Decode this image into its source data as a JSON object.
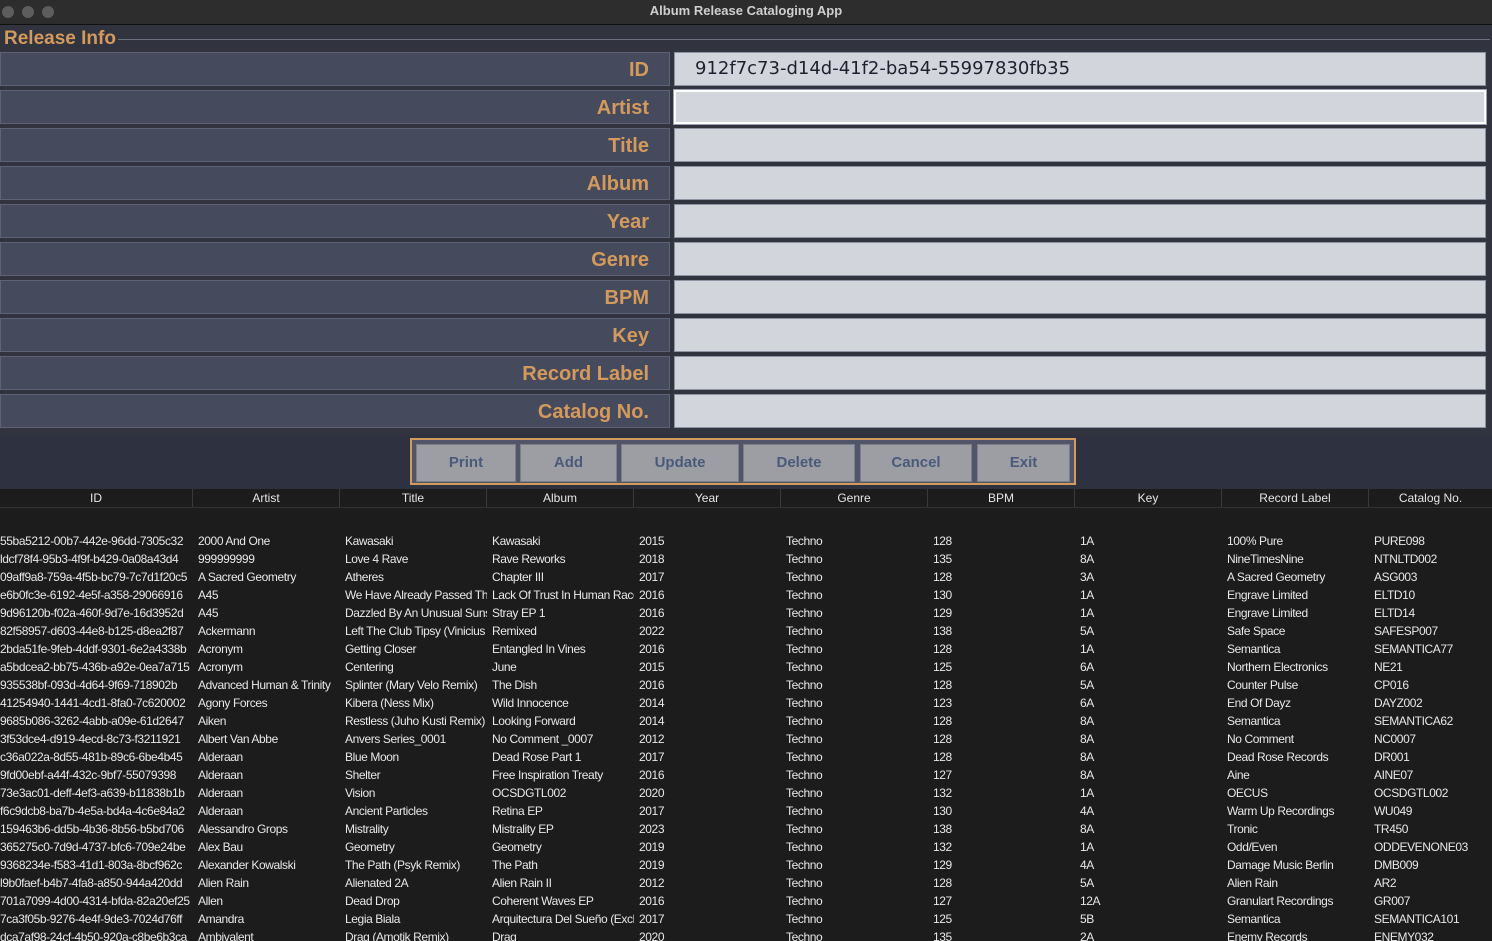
{
  "window": {
    "title": "Album Release Cataloging App"
  },
  "release_info": {
    "legend": "Release Info",
    "fields": [
      {
        "label": "ID",
        "value": "912f7c73-d14d-41f2-ba54-55997830fb35"
      },
      {
        "label": "Artist",
        "value": ""
      },
      {
        "label": "Title",
        "value": ""
      },
      {
        "label": "Album",
        "value": ""
      },
      {
        "label": "Year",
        "value": ""
      },
      {
        "label": "Genre",
        "value": ""
      },
      {
        "label": "BPM",
        "value": ""
      },
      {
        "label": "Key",
        "value": ""
      },
      {
        "label": "Record Label",
        "value": ""
      },
      {
        "label": "Catalog No.",
        "value": ""
      }
    ]
  },
  "buttons": [
    "Print",
    "Add",
    "Update",
    "Delete",
    "Cancel",
    "Exit"
  ],
  "table": {
    "columns": [
      "ID",
      "Artist",
      "Title",
      "Album",
      "Year",
      "Genre",
      "BPM",
      "Key",
      "Record Label",
      "Catalog No."
    ],
    "rows": [
      [
        "55ba5212-00b7-442e-96dd-7305c32",
        "2000 And One",
        "Kawasaki",
        "Kawasaki",
        "2015",
        "Techno",
        "128",
        "1A",
        "100% Pure",
        "PURE098"
      ],
      [
        "ldcf78f4-95b3-4f9f-b429-0a08a43d4",
        "999999999",
        "Love 4 Rave",
        "Rave Reworks",
        "2018",
        "Techno",
        "135",
        "8A",
        "NineTimesNine",
        "NTNLTD002"
      ],
      [
        "09aff9a8-759a-4f5b-bc79-7c7d1f20c5",
        "A Sacred Geometry",
        "Atheres",
        "Chapter III",
        "2017",
        "Techno",
        "128",
        "3A",
        "A Sacred Geometry",
        "ASG003"
      ],
      [
        "e6b0fc3e-6192-4e5f-a358-29066916",
        "A45",
        "We Have Already Passed The F",
        "Lack Of Trust In Human Race",
        "2016",
        "Techno",
        "130",
        "1A",
        "Engrave Limited",
        "ELTD10"
      ],
      [
        "9d96120b-f02a-460f-9d7e-16d3952d",
        "A45",
        "Dazzled By An Unusual Sunsh",
        "Stray EP 1",
        "2016",
        "Techno",
        "129",
        "1A",
        "Engrave Limited",
        "ELTD14"
      ],
      [
        "82f58957-d603-44e8-b125-d8ea2f87",
        "Ackermann",
        "Left The Club Tipsy (Vinicius H",
        "Remixed",
        "2022",
        "Techno",
        "138",
        "5A",
        "Safe Space",
        "SAFESP007"
      ],
      [
        "2bda51fe-9feb-4ddf-9301-6e2a4338b",
        "Acronym",
        "Getting Closer",
        "Entangled In Vines",
        "2016",
        "Techno",
        "128",
        "1A",
        "Semantica",
        "SEMANTICA77"
      ],
      [
        "a5bdcea2-bb75-436b-a92e-0ea7a715",
        "Acronym",
        "Centering",
        "June",
        "2015",
        "Techno",
        "125",
        "6A",
        "Northern Electronics",
        "NE21"
      ],
      [
        "935538bf-093d-4d64-9f69-718902b",
        "Advanced Human & Trinity",
        "Splinter (Mary Velo Remix)",
        "The Dish",
        "2016",
        "Techno",
        "128",
        "5A",
        "Counter Pulse",
        "CP016"
      ],
      [
        "41254940-1441-4cd1-8fa0-7c620002",
        "Agony Forces",
        "Kibera (Ness Mix)",
        "Wild Innocence",
        "2014",
        "Techno",
        "123",
        "6A",
        "End Of Dayz",
        "DAYZ002"
      ],
      [
        "9685b086-3262-4abb-a09e-61d2647",
        "Aiken",
        "Restless (Juho Kusti Remix)",
        "Looking Forward",
        "2014",
        "Techno",
        "128",
        "8A",
        "Semantica",
        "SEMANTICA62"
      ],
      [
        "3f53dce4-d919-4ecd-8c73-f3211921",
        "Albert Van Abbe",
        "Anvers Series_0001",
        "No Comment _0007",
        "2012",
        "Techno",
        "128",
        "8A",
        "No Comment",
        "NC0007"
      ],
      [
        "c36a022a-8d55-481b-89c6-6be4b45",
        "Alderaan",
        "Blue Moon",
        "Dead Rose Part 1",
        "2017",
        "Techno",
        "128",
        "8A",
        "Dead Rose Records",
        "DR001"
      ],
      [
        "9fd00ebf-a44f-432c-9bf7-55079398",
        "Alderaan",
        "Shelter",
        "Free Inspiration Treaty",
        "2016",
        "Techno",
        "127",
        "8A",
        "Aine",
        "AINE07"
      ],
      [
        "73e3ac01-deff-4ef3-a639-b11838b1b",
        "Alderaan",
        "Vision",
        "OCSDGTL002",
        "2020",
        "Techno",
        "132",
        "1A",
        "OECUS",
        "OCSDGTL002"
      ],
      [
        "f6c9dcb8-ba7b-4e5a-bd4a-4c6e84a2",
        "Alderaan",
        "Ancient Particles",
        "Retina EP",
        "2017",
        "Techno",
        "130",
        "4A",
        "Warm Up Recordings",
        "WU049"
      ],
      [
        "159463b6-dd5b-4b36-8b56-b5bd706",
        "Alessandro Grops",
        "Mistrality",
        "Mistrality EP",
        "2023",
        "Techno",
        "138",
        "8A",
        "Tronic",
        "TR450"
      ],
      [
        "365275c0-7d9d-4737-bfc6-709e24be",
        "Alex Bau",
        "Geometry",
        "Geometry",
        "2019",
        "Techno",
        "132",
        "1A",
        "Odd/Even",
        "ODDEVENONE03"
      ],
      [
        "9368234e-f583-41d1-803a-8bcf962c",
        "Alexander Kowalski",
        "The Path (Psyk Remix)",
        "The Path",
        "2019",
        "Techno",
        "129",
        "4A",
        "Damage Music Berlin",
        "DMB009"
      ],
      [
        "l9b0faef-b4b7-4fa8-a850-944a420dd",
        "Alien Rain",
        "Alienated 2A",
        "Alien Rain II",
        "2012",
        "Techno",
        "128",
        "5A",
        "Alien Rain",
        "AR2"
      ],
      [
        "701a7099-4d00-4314-bfda-82a20ef25",
        "Allen",
        "Dead Drop",
        "Coherent Waves EP",
        "2016",
        "Techno",
        "127",
        "12A",
        "Granulart Recordings",
        "GR007"
      ],
      [
        "7ca3f05b-9276-4e4f-9de3-7024d76ff",
        "Amandra",
        "Legia Biala",
        "Arquitectura Del Sueño (Exclus",
        "2017",
        "Techno",
        "125",
        "5B",
        "Semantica",
        "SEMANTICA101"
      ],
      [
        "dca7af98-24cf-4b50-920a-c8be6b3ca",
        "Ambivalent",
        "Drag (Amotik Remix)",
        "Drag",
        "2020",
        "Techno",
        "135",
        "2A",
        "Enemy Records",
        "ENEMY032"
      ]
    ]
  }
}
